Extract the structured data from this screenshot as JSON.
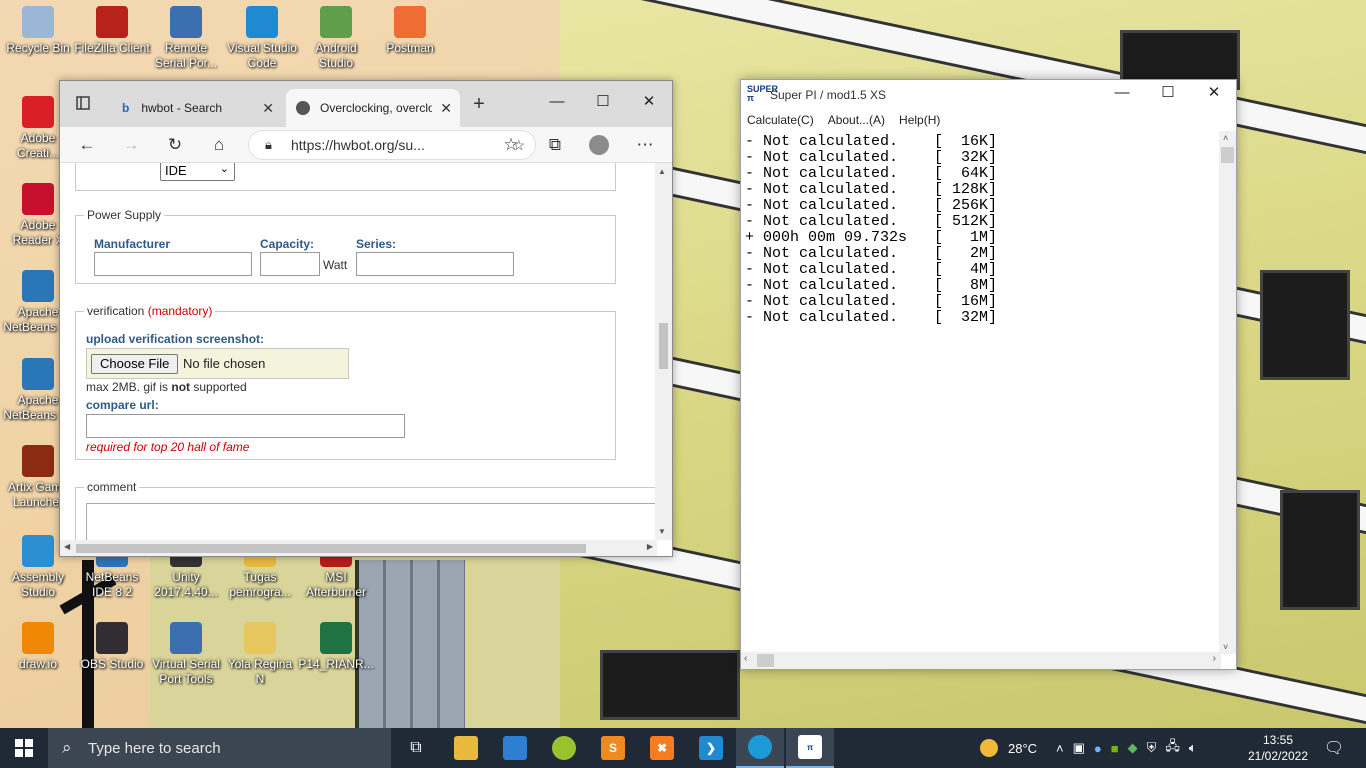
{
  "desktop": {
    "icons": [
      {
        "label": "Recycle Bin",
        "icon": "recycle-bin-icon",
        "color": "#9bb6d6"
      },
      {
        "label": "FileZilla Client",
        "icon": "filezilla-icon",
        "color": "#b7231b"
      },
      {
        "label": "Remote Serial Por...",
        "icon": "remote-serial-icon",
        "color": "#3c6fb0"
      },
      {
        "label": "Visual Studio Code",
        "icon": "vscode-icon",
        "color": "#1f8ad2"
      },
      {
        "label": "Android Studio",
        "icon": "android-studio-icon",
        "color": "#5f9e4a"
      },
      {
        "label": "Postman",
        "icon": "postman-icon",
        "color": "#ef6c32"
      },
      {
        "label": "Adobe Creati...",
        "icon": "adobe-cc-icon",
        "color": "#da1f26"
      },
      {
        "label": "Adobe Reader X",
        "icon": "adobe-reader-icon",
        "color": "#c8102e"
      },
      {
        "label": "Apache NetBeans I...",
        "icon": "netbeans-icon",
        "color": "#2a77b8"
      },
      {
        "label": "Apache NetBeans I...",
        "icon": "netbeans-icon",
        "color": "#2a77b8"
      },
      {
        "label": "Artix Game Launcher",
        "icon": "artix-icon",
        "color": "#8a2b12"
      },
      {
        "label": "Assembly Studio",
        "icon": "assembly-studio-icon",
        "color": "#2b8fd1"
      },
      {
        "label": "NetBeans IDE 8.2",
        "icon": "netbeans-ide-icon",
        "color": "#2a77b8"
      },
      {
        "label": "Unity 2017.4.40...",
        "icon": "unity-icon",
        "color": "#333333"
      },
      {
        "label": "Tugas pemrogra...",
        "icon": "folder-icon",
        "color": "#e8b93d"
      },
      {
        "label": "MSI Afterburner",
        "icon": "msi-afterburner-icon",
        "color": "#b71c1c"
      },
      {
        "label": "draw.io",
        "icon": "drawio-icon",
        "color": "#f08705"
      },
      {
        "label": "OBS Studio",
        "icon": "obs-icon",
        "color": "#302e31"
      },
      {
        "label": "Virtual Serial Port Tools",
        "icon": "virtual-serial-icon",
        "color": "#3c6fb0"
      },
      {
        "label": "Yola Regina N",
        "icon": "zip-folder-icon",
        "color": "#e8c660"
      },
      {
        "label": "P14_RIANR...",
        "icon": "excel-icon",
        "color": "#1f7244"
      }
    ]
  },
  "edge": {
    "tabs": [
      {
        "label": "hwbot - Search"
      },
      {
        "label": "Overclocking, overclo"
      }
    ],
    "url": "https://hwbot.org/su...",
    "form": {
      "ide_select": "IDE",
      "power_supply": {
        "legend": "Power Supply",
        "manufacturer_label": "Manufacturer",
        "capacity_label": "Capacity:",
        "watt_label": "Watt",
        "series_label": "Series:"
      },
      "verification": {
        "legend": "verification",
        "mandatory": "(mandatory)",
        "upload_label": "upload verification screenshot:",
        "choose_file": "Choose File",
        "no_file": "No file chosen",
        "max_note_a": "max 2MB. gif is ",
        "max_note_b": "not",
        "max_note_c": " supported",
        "compare_label": "compare url:",
        "required_note": "required for top 20 hall of fame"
      },
      "comment_legend": "comment"
    }
  },
  "superpi": {
    "title": "Super PI / mod1.5 XS",
    "menu": [
      "Calculate(C)",
      "About...(A)",
      "Help(H)"
    ],
    "lines": [
      "- Not calculated.    [  16K]",
      "- Not calculated.    [  32K]",
      "- Not calculated.    [  64K]",
      "- Not calculated.    [ 128K]",
      "- Not calculated.    [ 256K]",
      "- Not calculated.    [ 512K]",
      "+ 000h 00m 09.732s   [   1M]",
      "- Not calculated.    [   2M]",
      "- Not calculated.    [   4M]",
      "- Not calculated.    [   8M]",
      "- Not calculated.    [  16M]",
      "- Not calculated.    [  32M]"
    ]
  },
  "taskbar": {
    "search_placeholder": "Type here to search",
    "temperature": "28°C",
    "time": "13:55",
    "date": "21/02/2022"
  }
}
